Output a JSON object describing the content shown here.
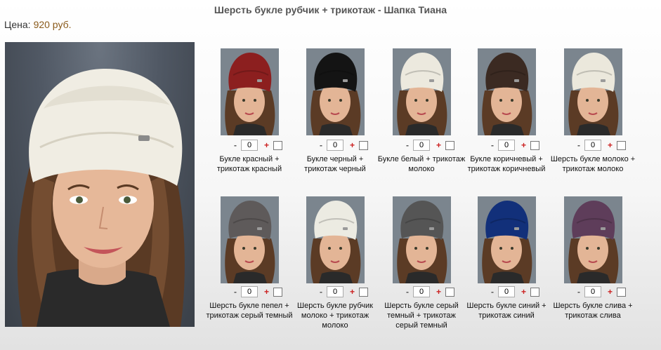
{
  "page": {
    "title": "Шерсть букле рубчик + трикотаж - Шапка Тиана"
  },
  "price": {
    "label": "Цена:",
    "value": "920 руб."
  },
  "colors": {
    "price_value": "#8a5a1a",
    "plus": "#cc2222"
  },
  "products": [
    {
      "name": "Букле красный + трикотаж красный",
      "qty": "0",
      "minus": "-",
      "plus": "+",
      "hat_color": "#8c1f1f"
    },
    {
      "name": "Букле черный + трикотаж черный",
      "qty": "0",
      "minus": "-",
      "plus": "+",
      "hat_color": "#141414"
    },
    {
      "name": "Букле белый + трикотаж молоко",
      "qty": "0",
      "minus": "-",
      "plus": "+",
      "hat_color": "#ece9de"
    },
    {
      "name": "Букле коричневый + трикотаж коричневый",
      "qty": "0",
      "minus": "-",
      "plus": "+",
      "hat_color": "#3b2a22"
    },
    {
      "name": "Шерсть букле молоко + трикотаж молоко",
      "qty": "0",
      "minus": "-",
      "plus": "+",
      "hat_color": "#ebe8dc"
    },
    {
      "name": "Шерсть букле пепел + трикотаж серый темный",
      "qty": "0",
      "minus": "-",
      "plus": "+",
      "hat_color": "#5e5a5a"
    },
    {
      "name": "Шерсть букле рубчик молоко + трикотаж молоко",
      "qty": "0",
      "minus": "-",
      "plus": "+",
      "hat_color": "#ecebe2"
    },
    {
      "name": "Шерсть букле серый темный + трикотаж серый темный",
      "qty": "0",
      "minus": "-",
      "plus": "+",
      "hat_color": "#555555"
    },
    {
      "name": "Шерсть букле синий + трикотаж синий",
      "qty": "0",
      "minus": "-",
      "plus": "+",
      "hat_color": "#12307a"
    },
    {
      "name": "Шерсть букле слива + трикотаж слива",
      "qty": "0",
      "minus": "-",
      "plus": "+",
      "hat_color": "#5e3d5a"
    }
  ]
}
